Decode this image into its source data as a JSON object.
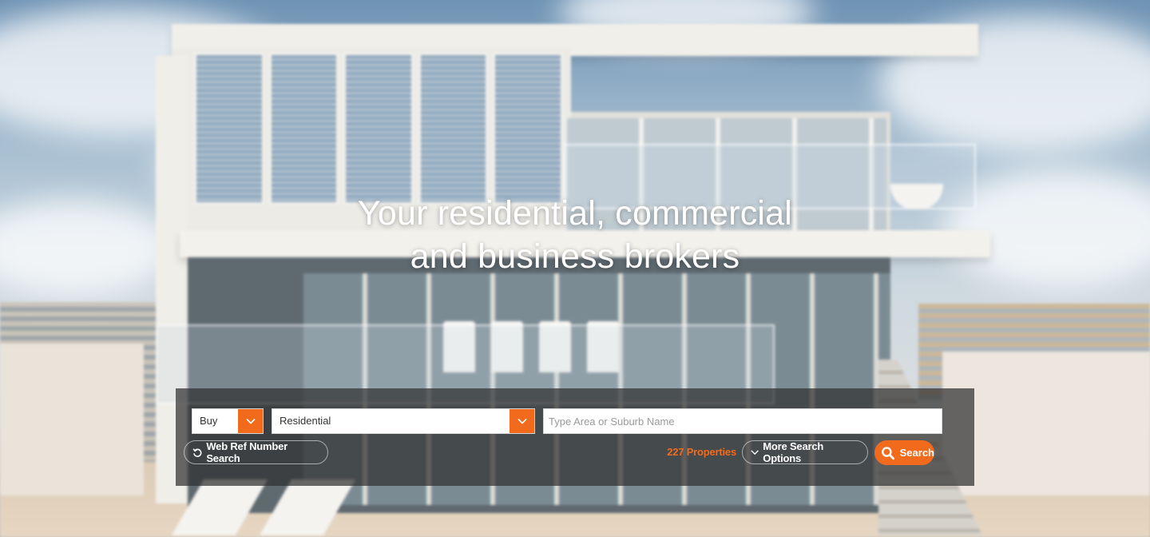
{
  "hero": {
    "title_line1": "Your residential, commercial",
    "title_line2": "and business brokers"
  },
  "search": {
    "listing_type": {
      "value": "Buy"
    },
    "property_category": {
      "value": "Residential"
    },
    "location": {
      "placeholder": "Type Area or Suburb Name",
      "value": ""
    },
    "web_ref_label": "Web Ref Number Search",
    "results_count": "227 Properties",
    "more_options_label": "More Search Options",
    "search_label": "Search"
  },
  "colors": {
    "accent": "#f26b1d",
    "panel": "rgba(48,48,48,0.72)",
    "heading": "#ffffff"
  },
  "icons": {
    "dropdown": "chevron-down-icon",
    "web_ref": "refresh-icon",
    "more_options": "chevron-down-icon",
    "search": "magnifier-icon"
  }
}
